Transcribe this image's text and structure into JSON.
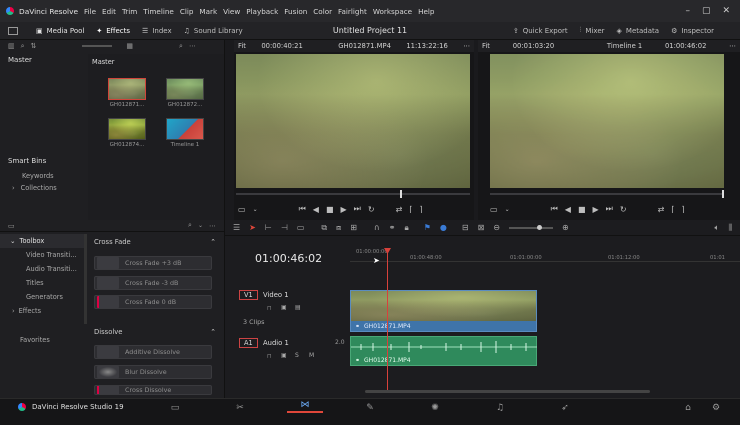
{
  "app": {
    "title": "DaVinci Resolve",
    "project_title": "Untitled Project 11"
  },
  "menu": [
    "File",
    "Edit",
    "Trim",
    "Timeline",
    "Clip",
    "Mark",
    "View",
    "Playback",
    "Fusion",
    "Color",
    "Fairlight",
    "Workspace",
    "Help"
  ],
  "toolbar": {
    "media_pool": "Media Pool",
    "effects": "Effects",
    "index": "Index",
    "sound_library": "Sound Library",
    "quick_export": "Quick Export",
    "mixer": "Mixer",
    "metadata": "Metadata",
    "inspector": "Inspector"
  },
  "left": {
    "master_header": "Master",
    "master_folder": "Master",
    "smart_bins": "Smart Bins",
    "keywords": "Keywords",
    "collections": "Collections"
  },
  "clips": [
    {
      "name": "GH012871..."
    },
    {
      "name": "GH012872..."
    },
    {
      "name": "GH012874..."
    },
    {
      "name": "Timeline 1"
    }
  ],
  "viewer_source": {
    "zoom": "Fit",
    "timecode": "00:00:40:21",
    "clip": "GH012871.MP4",
    "end_tc": "11:13:22:16"
  },
  "viewer_timeline": {
    "zoom": "Fit",
    "timecode": "00:01:03:20",
    "clip": "Timeline 1",
    "end_tc": "01:00:46:02"
  },
  "toolbox": {
    "items": [
      "Toolbox",
      "Video Transiti...",
      "Audio Transiti...",
      "Titles",
      "Generators",
      "Effects"
    ],
    "favorites": "Favorites"
  },
  "effects": {
    "cross_fade_header": "Cross Fade",
    "cross_fades": [
      "Cross Fade +3 dB",
      "Cross Fade -3 dB",
      "Cross Fade 0 dB"
    ],
    "dissolve_header": "Dissolve",
    "dissolves": [
      "Additive Dissolve",
      "Blur Dissolve",
      "Cross Dissolve"
    ]
  },
  "timeline": {
    "timecode": "01:00:46:02",
    "ruler": [
      "01:00:00:00",
      "01:00:48:00",
      "01:01:00:00",
      "01:01:12:00",
      "01:01"
    ],
    "video_track": {
      "id": "V1",
      "name": "Video 1",
      "clips_count": "3 Clips",
      "clip": "GH012871.MP4"
    },
    "audio_track": {
      "id": "A1",
      "name": "Audio 1",
      "level": "2.0",
      "clip": "GH012871.MP4"
    }
  },
  "bottom": {
    "brand": "DaVinci Resolve Studio 19"
  },
  "colors": {
    "accent": "#e0473a",
    "video_clip": "#3f74a9",
    "audio_clip": "#2f8a5c",
    "playhead": "#d8413b"
  }
}
